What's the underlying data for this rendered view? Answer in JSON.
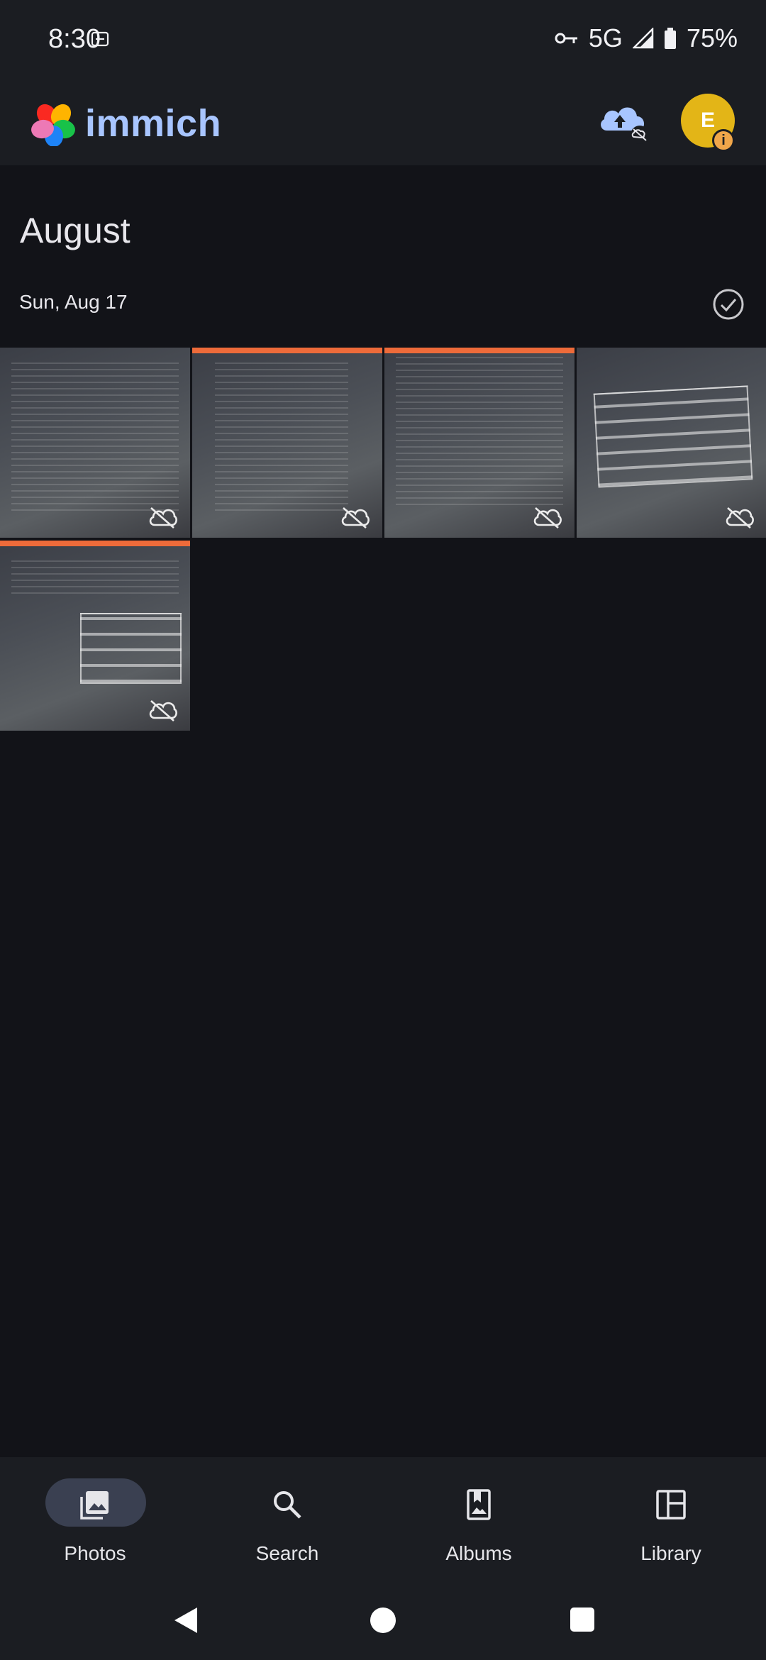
{
  "status_bar": {
    "time": "8:30",
    "network": "5G",
    "battery": "75%",
    "icons": [
      "vpn-icon",
      "key-icon",
      "signal-icon",
      "battery-icon"
    ]
  },
  "app_bar": {
    "logo_text": "immich",
    "avatar_letter": "E",
    "avatar_badge": "i",
    "avatar_color": "#e3b517",
    "accent_color": "#a8c5ff"
  },
  "timeline": {
    "month": "August",
    "day": "Sun, Aug 17",
    "photo_count": 5
  },
  "bottom_nav": {
    "items": [
      {
        "label": "Photos",
        "icon": "photos-icon",
        "active": true
      },
      {
        "label": "Search",
        "icon": "search-icon",
        "active": false
      },
      {
        "label": "Albums",
        "icon": "albums-icon",
        "active": false
      },
      {
        "label": "Library",
        "icon": "library-icon",
        "active": false
      }
    ]
  }
}
